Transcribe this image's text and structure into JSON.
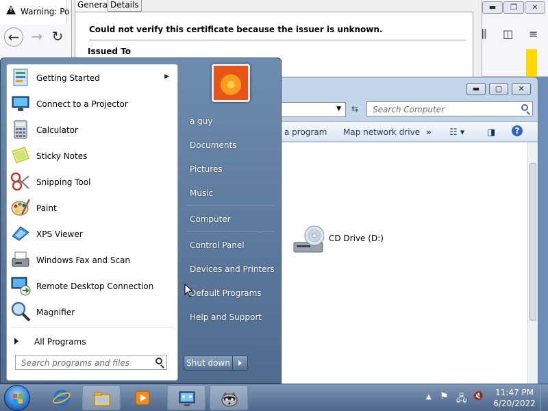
{
  "browser": {
    "tab_title": "Warning: Po"
  },
  "cert_dialog": {
    "tab_general": "General",
    "tab_details": "Details",
    "message": "Could not verify this certificate because the issuer is unknown.",
    "issued_to": "Issued To"
  },
  "explorer": {
    "search_placeholder": "Search Computer",
    "toolbar": {
      "program_partial": "a program",
      "map_network_drive": "Map network drive",
      "more": "»"
    },
    "drive_label": "CD Drive (D:)"
  },
  "start_menu": {
    "programs": [
      {
        "label": "Getting Started",
        "icon": "getting-started-icon",
        "has_submenu": true
      },
      {
        "label": "Connect to a Projector",
        "icon": "projector-icon"
      },
      {
        "label": "Calculator",
        "icon": "calculator-icon"
      },
      {
        "label": "Sticky Notes",
        "icon": "sticky-notes-icon"
      },
      {
        "label": "Snipping Tool",
        "icon": "scissors-icon"
      },
      {
        "label": "Paint",
        "icon": "paint-palette-icon"
      },
      {
        "label": "XPS Viewer",
        "icon": "xps-viewer-icon"
      },
      {
        "label": "Windows Fax and Scan",
        "icon": "fax-icon"
      },
      {
        "label": "Remote Desktop Connection",
        "icon": "remote-desktop-icon"
      },
      {
        "label": "Magnifier",
        "icon": "magnifier-icon"
      }
    ],
    "all_programs": "All Programs",
    "search_placeholder": "Search programs and files",
    "user_name": "a guy",
    "right_items": [
      "Documents",
      "Pictures",
      "Music",
      "Computer",
      "Control Panel",
      "Devices and Printers",
      "Default Programs",
      "Help and Support"
    ],
    "shutdown_label": "Shut down"
  },
  "taskbar": {
    "time": "11:47 PM",
    "date": "6/20/2022",
    "pinned": [
      "internet-explorer-icon",
      "file-explorer-icon",
      "media-player-icon",
      "network-app-icon",
      "raccoon-app-icon"
    ]
  },
  "colors": {
    "taskbar": "#5a759a",
    "start_menu": "#5e7ba0",
    "yellow_accent": "#ffd800"
  }
}
